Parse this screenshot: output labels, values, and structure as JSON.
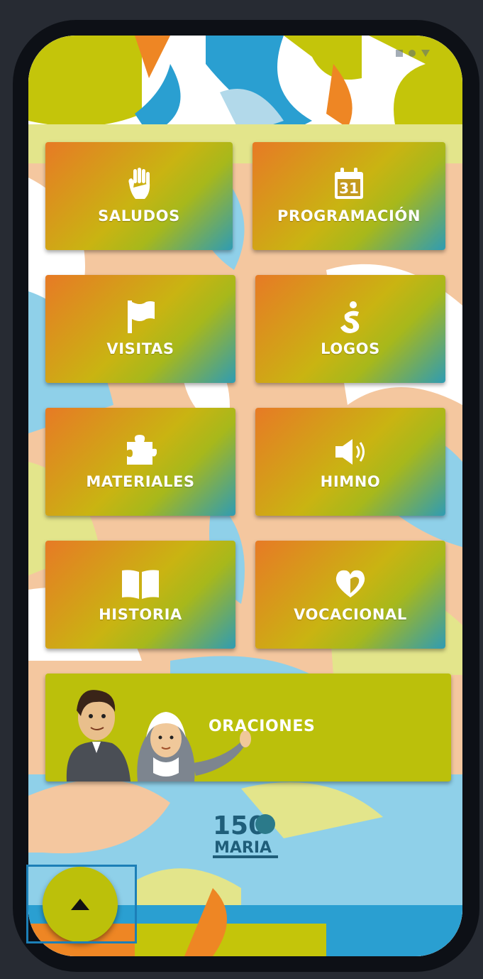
{
  "menu": {
    "saludos": {
      "label": "SALUDOS",
      "icon": "hand-icon"
    },
    "programacion": {
      "label": "PROGRAMACIÓN",
      "icon": "calendar-icon",
      "calendar_day": "31"
    },
    "visitas": {
      "label": "VISITAS",
      "icon": "flag-icon"
    },
    "logos": {
      "label": "LOGOS",
      "icon": "logo-figure-icon"
    },
    "materiales": {
      "label": "MATERIALES",
      "icon": "puzzle-icon"
    },
    "himno": {
      "label": "HIMNO",
      "icon": "speaker-icon"
    },
    "historia": {
      "label": "HISTORIA",
      "icon": "book-icon"
    },
    "vocacional": {
      "label": "VOCACIONAL",
      "icon": "heart-icon"
    }
  },
  "banner": {
    "label": "ORACIONES"
  },
  "logo": {
    "number": "150",
    "name": "MARIA"
  },
  "fab": {
    "icon": "arrow-up-icon"
  },
  "colors": {
    "gradient_orange": "#e77a25",
    "gradient_lime": "#c9b412",
    "gradient_teal": "#2f9cb3",
    "banner": "#bbc00b",
    "fab": "#bcc00a",
    "focus_outline": "#1c7fb7"
  }
}
